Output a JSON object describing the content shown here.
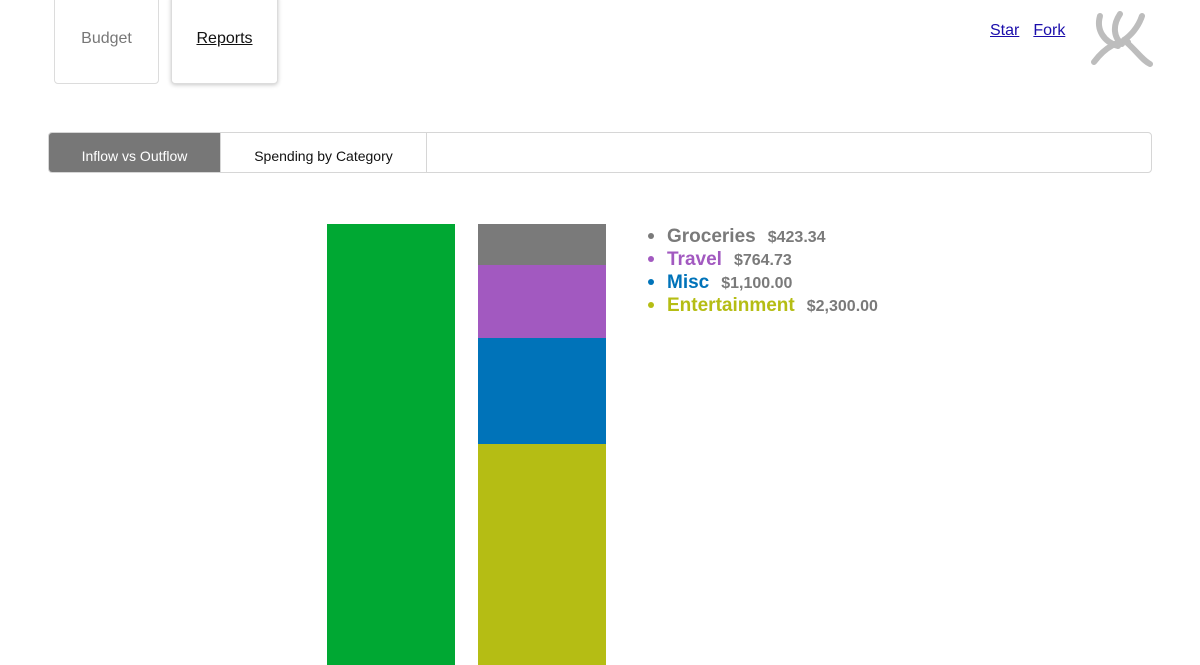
{
  "nav": {
    "budget_label": "Budget",
    "reports_label": "Reports"
  },
  "github": {
    "star_label": "Star",
    "fork_label": "Fork"
  },
  "report_tabs": [
    {
      "label": "Inflow vs Outflow",
      "active": true
    },
    {
      "label": "Spending by Category",
      "active": false
    }
  ],
  "chart_data": {
    "type": "bar",
    "stacked": true,
    "inflow": {
      "value": 4588.07,
      "color": "#00a833"
    },
    "outflow": [
      {
        "name": "Groceries",
        "value": 423.34,
        "color": "#7a7a7a"
      },
      {
        "name": "Travel",
        "value": 764.73,
        "color": "#a259c0"
      },
      {
        "name": "Misc",
        "value": 1100.0,
        "color": "#0073b9"
      },
      {
        "name": "Entertainment",
        "value": 2300.0,
        "color": "#b5bd14"
      }
    ],
    "legend": [
      {
        "name": "Groceries",
        "amount": "$423.34",
        "color": "#7a7a7a"
      },
      {
        "name": "Travel",
        "amount": "$764.73",
        "color": "#a259c0"
      },
      {
        "name": "Misc",
        "amount": "$1,100.00",
        "color": "#0073b9"
      },
      {
        "name": "Entertainment",
        "amount": "$2,300.00",
        "color": "#b5bd14"
      }
    ]
  },
  "colors": {
    "active_tab": "#777777",
    "link": "#1a0dab"
  },
  "icons": {
    "logo": "leaf-logo-icon"
  }
}
